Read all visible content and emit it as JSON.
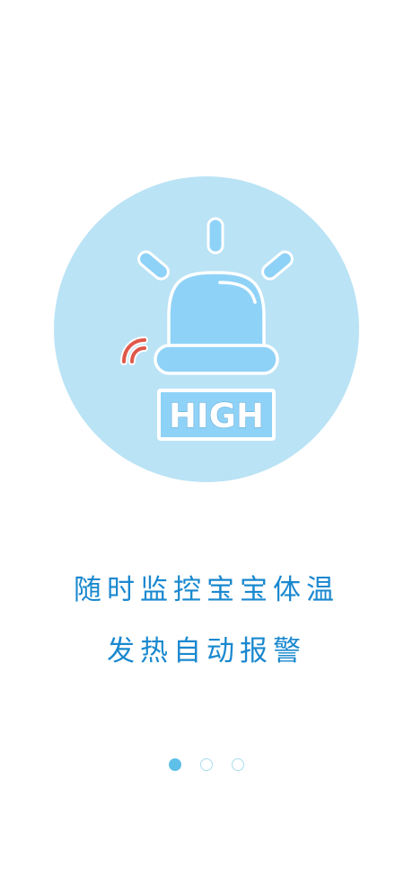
{
  "illustration": {
    "icon": "alarm-siren-icon",
    "badge_text": "HIGH",
    "circle_color": "#bae3f5",
    "siren_color": "#8fd2f7",
    "signal_color": "#e0584a"
  },
  "onboarding": {
    "line1": "随时监控宝宝体温",
    "line2": "发热自动报警",
    "text_color": "#1a88cf"
  },
  "pager": {
    "total_pages": 3,
    "active_page": 1,
    "active_color": "#5ec0e8"
  }
}
